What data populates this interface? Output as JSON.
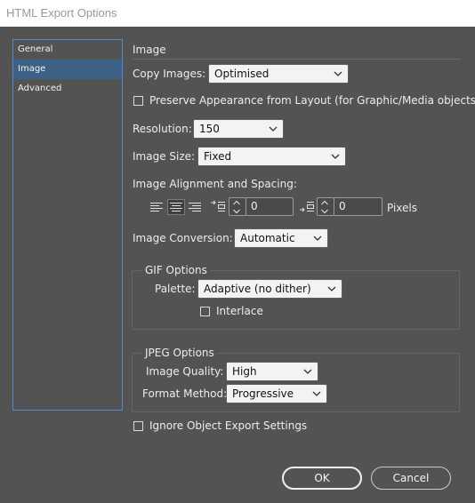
{
  "window": {
    "title": "HTML Export Options"
  },
  "nav": {
    "items": [
      "General",
      "Image",
      "Advanced"
    ],
    "selected": "Image"
  },
  "image_section": {
    "title": "Image",
    "copy_images": {
      "label": "Copy Images:",
      "value": "Optimised"
    },
    "preserve_appearance": {
      "label": "Preserve Appearance from Layout (for Graphic/Media objects)",
      "checked": false
    },
    "resolution": {
      "label": "Resolution:",
      "value": "150"
    },
    "image_size": {
      "label": "Image Size:",
      "value": "Fixed"
    },
    "alignment": {
      "label": "Image Alignment and Spacing:",
      "selected_alignment": "center",
      "space_before": "0",
      "space_after": "0",
      "unit": "Pixels"
    },
    "image_conversion": {
      "label": "Image Conversion:",
      "value": "Automatic"
    }
  },
  "gif_options": {
    "title": "GIF Options",
    "palette": {
      "label": "Palette:",
      "value": "Adaptive (no dither)"
    },
    "interlace": {
      "label": "Interlace",
      "checked": false
    }
  },
  "jpeg_options": {
    "title": "JPEG Options",
    "image_quality": {
      "label": "Image Quality:",
      "value": "High"
    },
    "format_method": {
      "label": "Format Method:",
      "value": "Progressive"
    }
  },
  "ignore_object_export": {
    "label": "Ignore Object Export Settings",
    "checked": false
  },
  "buttons": {
    "ok": "OK",
    "cancel": "Cancel"
  },
  "colors": {
    "background": "#535353",
    "selection": "#3d6185",
    "focus_border": "#4d8bd2"
  }
}
